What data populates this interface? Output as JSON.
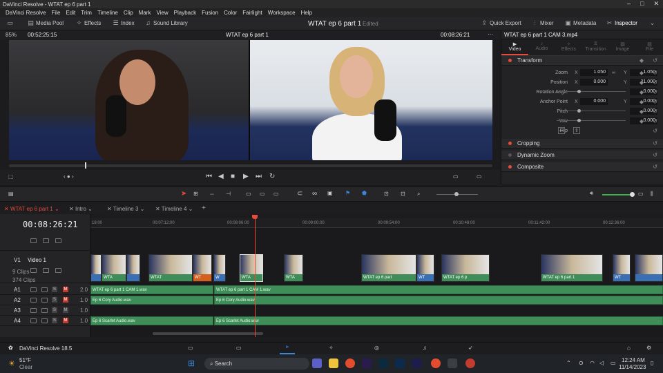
{
  "window": {
    "title": "DaVinci Resolve - WTAT ep 6 part 1"
  },
  "menu": [
    "DaVinci Resolve",
    "File",
    "Edit",
    "Trim",
    "Timeline",
    "Clip",
    "Mark",
    "View",
    "Playback",
    "Fusion",
    "Color",
    "Fairlight",
    "Workspace",
    "Help"
  ],
  "toolbar": {
    "media_pool": "Media Pool",
    "effects": "Effects",
    "index": "Index",
    "sound_library": "Sound Library",
    "project_title": "WTAT ep 6 part 1",
    "status": "Edited",
    "quick_export": "Quick Export",
    "mixer": "Mixer",
    "metadata": "Metadata",
    "inspector": "Inspector"
  },
  "viewer": {
    "zoom": "85%",
    "source_timecode": "00:52:25:15",
    "timeline_name": "WTAT ep 6 part 1",
    "record_timecode": "00:08:26:21"
  },
  "inspector": {
    "clip_name": "WTAT ep 6 part 1 CAM 3.mp4",
    "tabs": [
      "Video",
      "Audio",
      "Effects",
      "Transition",
      "Image",
      "File"
    ],
    "transform": {
      "label": "Transform",
      "zoom_label": "Zoom",
      "zoom_x": "1.050",
      "zoom_y": "1.050",
      "position_label": "Position",
      "pos_x": "0.000",
      "pos_y": "21.000",
      "rotation_label": "Rotation Angle",
      "rotation": "0.000",
      "anchor_label": "Anchor Point",
      "anchor_x": "0.000",
      "anchor_y": "0.000",
      "pitch_label": "Pitch",
      "pitch": "0.000",
      "yaw_label": "Yaw",
      "yaw": "0.000",
      "flip_label": "Flip"
    },
    "sections": [
      "Cropping",
      "Dynamic Zoom",
      "Composite"
    ]
  },
  "timeline": {
    "tabs": [
      "WTAT ep 6 part 1",
      "Intro",
      "Timeline 3",
      "Timeline 4"
    ],
    "timecode": "00:08:26:21",
    "ruler": [
      "18:00",
      "00:07:12:00",
      "00:08:06:00",
      "00:09:00:00",
      "00:09:54:00",
      "00:10:48:00",
      "00:11:42:00",
      "00:12:36:00"
    ],
    "v2_clips": "9 Clips",
    "v1_name": "Video 1",
    "v1_label": "V1",
    "v1_clips": "374 Clips",
    "audio": [
      {
        "label": "A1",
        "vol": "2.0"
      },
      {
        "label": "A2",
        "vol": "1.0"
      },
      {
        "label": "A3",
        "vol": "1.0"
      },
      {
        "label": "A4",
        "vol": "1.0"
      }
    ],
    "video_clip_labels": [
      "WTA",
      "WTAT",
      "WT",
      "W",
      "WTA",
      "WTA",
      "WTAT ep 6 part",
      "WT",
      "WTAT ep 6 p",
      "WTAT ep 6 part 1",
      "WT"
    ],
    "audio_clips": {
      "a1_1": "WTAT ep 6 part 1 CAM 1.wav",
      "a1_2": "WTAT ep 6 part 1 CAM 1.wav",
      "a2_1": "Ep 6 Cory Audio.wav",
      "a2_2": "Ep 6 Cory Audio.wav",
      "a4_1": "Ep 6 Scarlet Audio.wav",
      "a4_2": "Ep 6 Scarlet Audio.wav"
    }
  },
  "footer": {
    "app": "DaVinci Resolve 18.5"
  },
  "taskbar": {
    "temp": "51°F",
    "weather": "Clear",
    "search": "Search",
    "time": "12:24 AM",
    "date": "11/14/2023"
  },
  "colors": {
    "accent": "#e64b3c",
    "audio_clip": "#3f8e5a",
    "video_clip": "#3a6fb3"
  }
}
